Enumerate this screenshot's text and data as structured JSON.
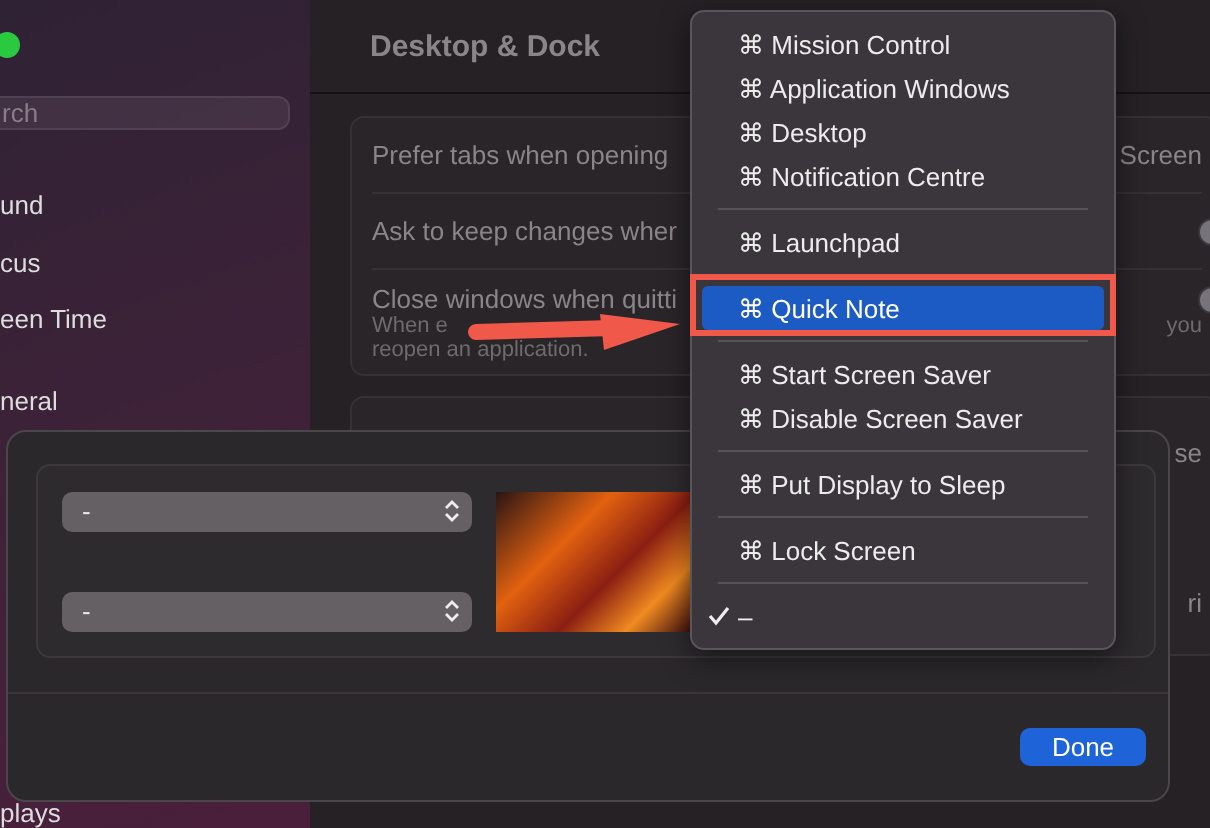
{
  "sidebar": {
    "search": {
      "placeholder": "rch"
    },
    "items": [
      {
        "label": "und"
      },
      {
        "label": "cus"
      },
      {
        "label": "een Time"
      },
      {
        "label": "neral"
      },
      {
        "label": "plays"
      }
    ]
  },
  "settings": {
    "title": "Desktop & Dock",
    "rows": [
      {
        "kind": "text",
        "label": "Prefer tabs when opening",
        "trailing": "Screen"
      },
      {
        "kind": "toggle",
        "label": "Ask to keep changes wher",
        "on": false
      },
      {
        "kind": "toggle",
        "label": "Close windows when quitti",
        "on": false,
        "subtitle": "When e",
        "subtitle_trailing": "you",
        "subtitle_2": "reopen an application."
      }
    ],
    "lower_rows": [
      {
        "trailing": "se"
      },
      {
        "trailing": "ri"
      }
    ]
  },
  "hot_corners": {
    "popups": [
      {
        "value": "-"
      },
      {
        "value": "-"
      }
    ],
    "done": "Done"
  },
  "menu": {
    "groups": [
      [
        {
          "label": "⌘ Mission Control",
          "selected": false,
          "checked": false
        },
        {
          "label": "⌘ Application Windows",
          "selected": false,
          "checked": false
        },
        {
          "label": "⌘ Desktop",
          "selected": false,
          "checked": false
        },
        {
          "label": "⌘ Notification Centre",
          "selected": false,
          "checked": false
        }
      ],
      [
        {
          "label": "⌘ Launchpad",
          "selected": false,
          "checked": false
        }
      ],
      [
        {
          "label": "⌘ Quick Note",
          "selected": true,
          "checked": false
        }
      ],
      [
        {
          "label": "⌘ Start Screen Saver",
          "selected": false,
          "checked": false
        },
        {
          "label": "⌘ Disable Screen Saver",
          "selected": false,
          "checked": false
        }
      ],
      [
        {
          "label": "⌘ Put Display to Sleep",
          "selected": false,
          "checked": false
        }
      ],
      [
        {
          "label": "⌘ Lock Screen",
          "selected": false,
          "checked": false
        }
      ],
      [
        {
          "label": "–",
          "selected": false,
          "checked": true
        }
      ]
    ]
  }
}
